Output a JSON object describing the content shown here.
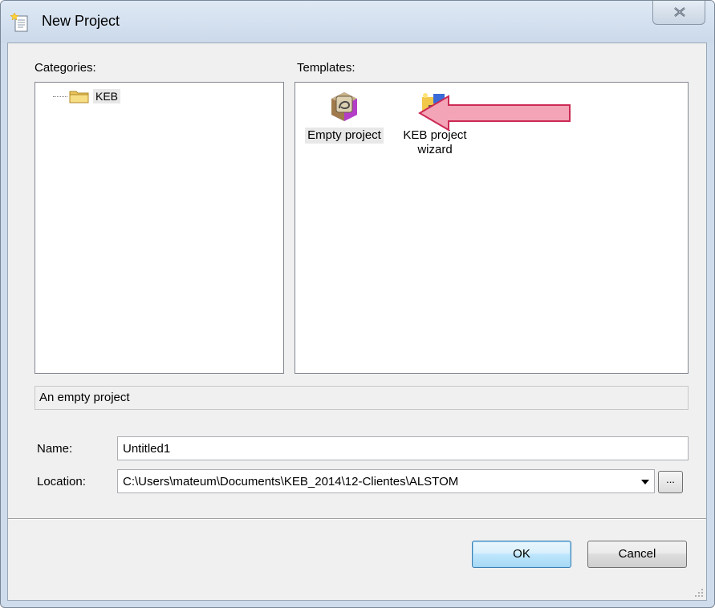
{
  "window": {
    "title": "New Project"
  },
  "categories": {
    "label": "Categories:",
    "items": [
      {
        "label": "KEB"
      }
    ]
  },
  "templates": {
    "label": "Templates:",
    "items": [
      {
        "label": "Empty project",
        "icon": "empty-project-icon",
        "selected": true
      },
      {
        "label": "KEB project wizard",
        "icon": "project-wizard-icon",
        "selected": false
      }
    ]
  },
  "description": "An empty project",
  "form": {
    "name_label": "Name:",
    "name_value": "Untitled1",
    "location_label": "Location:",
    "location_value": "C:\\Users\\mateum\\Documents\\KEB_2014\\12-Clientes\\ALSTOM",
    "browse_label": "..."
  },
  "buttons": {
    "ok": "OK",
    "cancel": "Cancel"
  },
  "colors": {
    "annotation_arrow": "#f3a4b6",
    "annotation_arrow_border": "#cc2a55"
  }
}
